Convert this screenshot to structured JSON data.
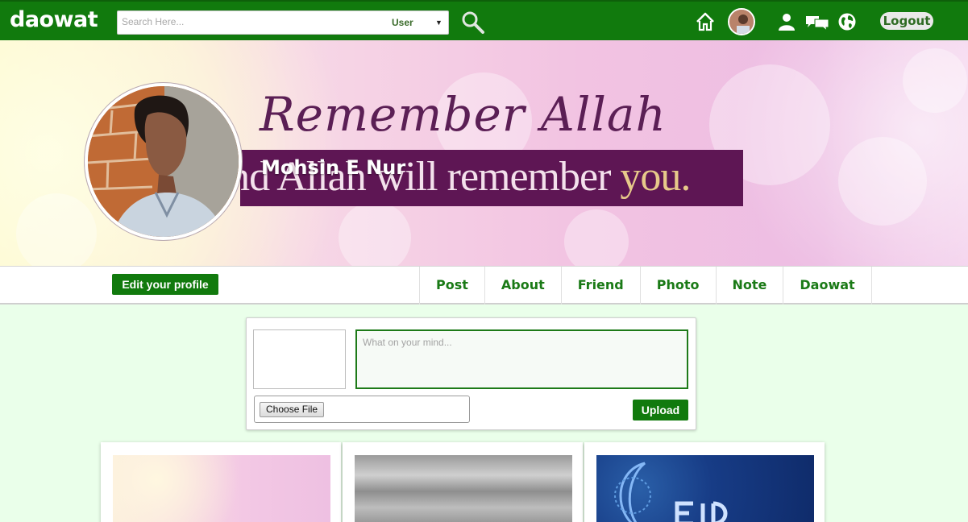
{
  "app": {
    "logo": "daowat"
  },
  "search": {
    "placeholder": "Search Here...",
    "selected_option": "User"
  },
  "nav": {
    "logout_label": "Logout",
    "icons": [
      "home-icon",
      "profile-avatar",
      "user-icon",
      "messages-icon",
      "globe-icon"
    ]
  },
  "cover": {
    "headline": "Remember Allah",
    "subline_a": "and Allah will remember ",
    "subline_b": "you."
  },
  "profile": {
    "name": "Mohsin E Nur",
    "edit_label": "Edit your profile"
  },
  "tabs": [
    "Post",
    "About",
    "Friend",
    "Photo",
    "Note",
    "Daowat"
  ],
  "composer": {
    "placeholder": "What on your mind...",
    "choose_file_label": "Choose File",
    "upload_label": "Upload"
  },
  "colors": {
    "brand": "#117a0d",
    "background": "#eaffea",
    "cover_band": "#5e1654"
  }
}
